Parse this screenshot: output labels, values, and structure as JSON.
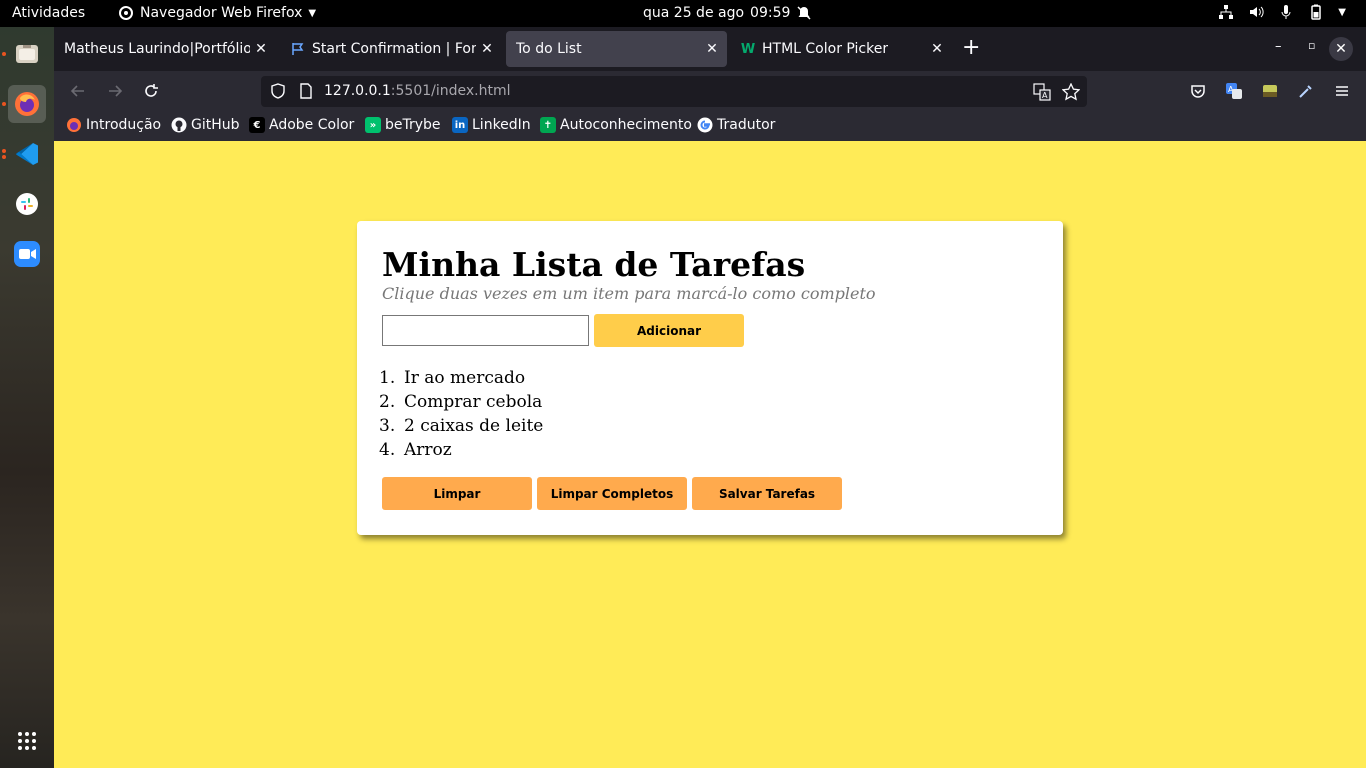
{
  "system_bar": {
    "activities": "Atividades",
    "app_name": "Navegador Web Firefox",
    "date": "qua 25 de ago",
    "time": "09:59"
  },
  "dock": {
    "items": [
      "files-icon",
      "firefox-icon",
      "vscode-icon",
      "slack-icon",
      "zoom-icon",
      "app-grid-icon"
    ]
  },
  "browser": {
    "tabs": [
      {
        "label": "Matheus Laurindo|Portfólio",
        "active": false
      },
      {
        "label": "Start Confirmation | Font",
        "active": false
      },
      {
        "label": "To do List",
        "active": true
      },
      {
        "label": "HTML Color Picker",
        "active": false
      }
    ],
    "url": {
      "host": "127.0.0.1",
      "rest": ":5501/index.html"
    },
    "bookmarks": [
      {
        "label": "Introdução",
        "icon": "firefox-icon"
      },
      {
        "label": "GitHub",
        "icon": "github-icon"
      },
      {
        "label": "Adobe Color",
        "icon": "adobe-color-icon"
      },
      {
        "label": "beTrybe",
        "icon": "betrybe-icon"
      },
      {
        "label": "LinkedIn",
        "icon": "linkedin-icon"
      },
      {
        "label": "Autoconhecimento",
        "icon": "autoconhecimento-icon"
      },
      {
        "label": "Tradutor",
        "icon": "google-icon"
      }
    ]
  },
  "todo": {
    "title": "Minha Lista de Tarefas",
    "subtitle": "Clique duas vezes em um item para marcá-lo como completo",
    "input_value": "",
    "add_button": "Adicionar",
    "tasks": [
      {
        "number": "1.",
        "text": "Ir ao mercado"
      },
      {
        "number": "2.",
        "text": "Comprar cebola"
      },
      {
        "number": "3.",
        "text": "2 caixas de leite"
      },
      {
        "number": "4.",
        "text": "Arroz"
      }
    ],
    "clear_button": "Limpar",
    "clear_completed_button": "Limpar Completos",
    "save_button": "Salvar Tarefas"
  },
  "colors": {
    "page_background": "#ffeb57",
    "add_button": "#ffcd4a",
    "action_buttons": "#ffaa4d"
  }
}
